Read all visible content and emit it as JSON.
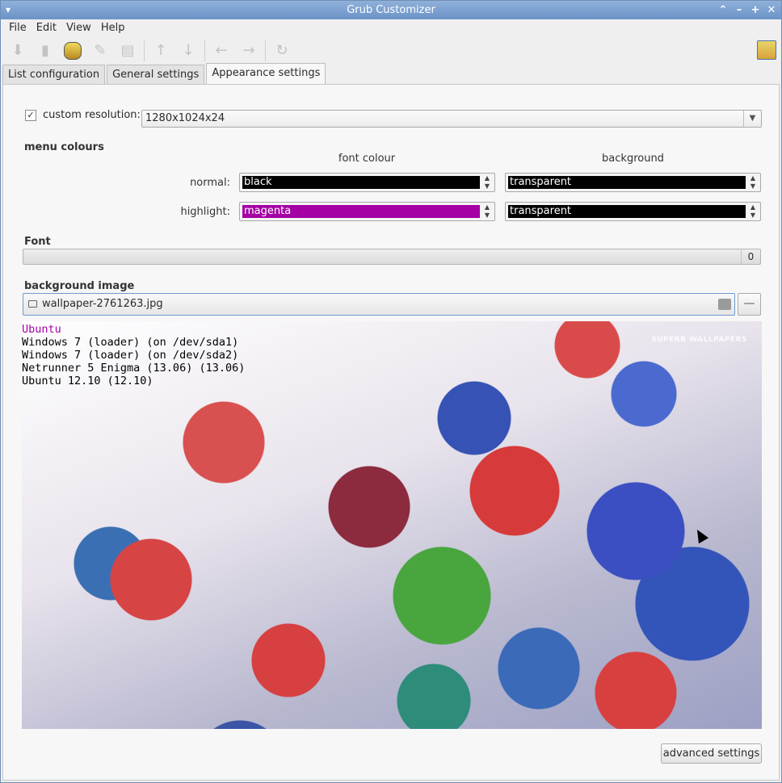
{
  "window": {
    "title": "Grub Customizer",
    "controls": [
      "+",
      "–",
      "+",
      "×"
    ]
  },
  "menubar": {
    "items": [
      "File",
      "Edit",
      "View",
      "Help"
    ]
  },
  "toolbar": {
    "icons": [
      "save-icon",
      "delete-icon",
      "install-icon",
      "edit-icon",
      "create-entry-icon",
      "move-up-icon",
      "move-down-icon",
      "move-left-icon",
      "move-right-icon",
      "revert-icon",
      "about-icon"
    ]
  },
  "tabs": [
    {
      "label": "List configuration",
      "active": false
    },
    {
      "label": "General settings",
      "active": false
    },
    {
      "label": "Appearance settings",
      "active": true
    }
  ],
  "resolution": {
    "checked": true,
    "label": "custom resolution:",
    "value": "1280x1024x24"
  },
  "menu_colours": {
    "title": "menu colours",
    "font_colour_header": "font colour",
    "background_header": "background",
    "normal": {
      "label": "normal:",
      "font": {
        "name": "black",
        "color": "#000000"
      },
      "background": {
        "name": "transparent",
        "color": "#000000"
      }
    },
    "highlight": {
      "label": "highlight:",
      "font": {
        "name": "magenta",
        "color": "#a400a4"
      },
      "background": {
        "name": "transparent",
        "color": "#000000"
      }
    }
  },
  "font": {
    "title": "Font",
    "value": "0"
  },
  "background_image": {
    "title": "background image",
    "filename": "wallpaper-2761263.jpg"
  },
  "preview": {
    "entries": [
      {
        "text": "Ubuntu",
        "highlighted": true
      },
      {
        "text": "Windows 7 (loader) (on /dev/sda1)",
        "highlighted": false
      },
      {
        "text": "Windows 7 (loader) (on /dev/sda2)",
        "highlighted": false
      },
      {
        "text": "Netrunner 5 Enigma (13.06) (13.06)",
        "highlighted": false
      },
      {
        "text": "Ubuntu 12.10 (12.10)",
        "highlighted": false
      }
    ],
    "watermark": "SUPERB WALLPAPERS"
  },
  "advanced_button": "advanced settings"
}
